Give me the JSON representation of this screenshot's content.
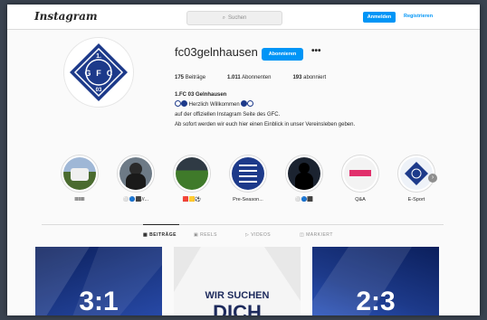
{
  "topbar": {
    "logo": "Instagram",
    "search_placeholder": "Suchen",
    "login_label": "Anmelden",
    "register_label": "Registrieren"
  },
  "profile": {
    "username": "fc03gelnhausen",
    "follow_label": "Abonnieren",
    "more": "•••",
    "stats": [
      {
        "value": "175",
        "label": "Beiträge"
      },
      {
        "value": "1.011",
        "label": "Abonnenten"
      },
      {
        "value": "193",
        "label": "abonniert"
      }
    ],
    "bio": {
      "name": "1.FC 03 Gelnhausen",
      "line1": "Herzlich Willkommen",
      "line2": "auf der offiziellen Instagram Seite des GFC.",
      "line3": "Ab sofort werden wir euch hier einen Einblick in unser Vereinsleben geben."
    },
    "crest_text": {
      "top": "1.",
      "left": "G",
      "mid": "F",
      "right": "C",
      "bottom": "03"
    }
  },
  "highlights": [
    {
      "label": "ⅢⅢⅢ",
      "icon": "team-photo"
    },
    {
      "label": "⚪🔵⬛//...",
      "icon": "player-photo"
    },
    {
      "label": "🟥🟨⚽",
      "icon": "field-photo"
    },
    {
      "label": "Pre-Season...",
      "icon": "lineup-graphic"
    },
    {
      "label": "⚪🔵⬛",
      "icon": "silhouette"
    },
    {
      "label": "Q&A",
      "icon": "qa-graphic"
    },
    {
      "label": "E-Sport",
      "icon": "crest-logo"
    }
  ],
  "tabs": [
    {
      "label": "BEITRÄGE",
      "active": true
    },
    {
      "label": "REELS",
      "active": false
    },
    {
      "label": "VIDEOS",
      "active": false
    },
    {
      "label": "MARKIERT",
      "active": false
    }
  ],
  "posts": [
    {
      "text": "3:1"
    },
    {
      "text_line1": "WIR SUCHEN",
      "text_line2": "DICH"
    },
    {
      "text": "2:3"
    }
  ],
  "colors": {
    "accent": "#0095f6",
    "club_blue": "#1d3a8a"
  }
}
